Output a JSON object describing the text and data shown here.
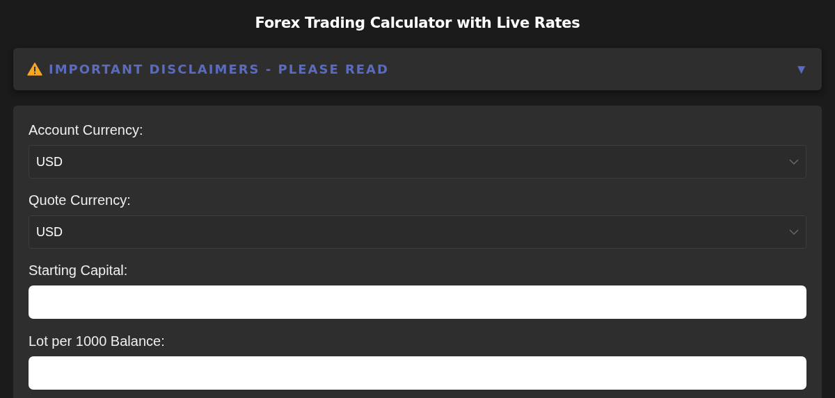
{
  "title": "Forex Trading Calculator with Live Rates",
  "disclaimer": {
    "label": "IMPORTANT DISCLAIMERS - PLEASE READ",
    "toggle": "▼",
    "expanded": false
  },
  "fields": [
    {
      "label": "Account Currency:",
      "kind": "select",
      "value": "USD"
    },
    {
      "label": "Quote Currency:",
      "kind": "select",
      "value": "USD"
    },
    {
      "label": "Starting Capital:",
      "kind": "input"
    },
    {
      "label": "Lot per 1000 Balance:",
      "kind": "input"
    }
  ]
}
